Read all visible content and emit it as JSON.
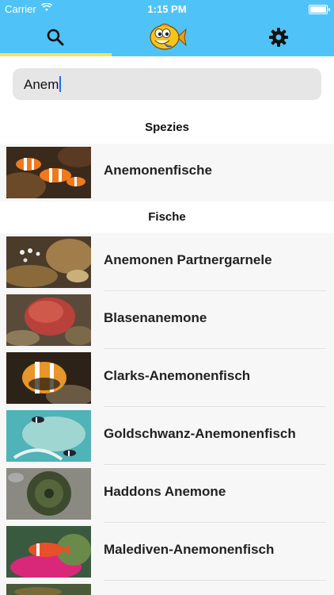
{
  "status_bar": {
    "carrier": "Carrier",
    "time": "1:15 PM"
  },
  "tabs": [
    {
      "name": "search",
      "icon": "search-icon"
    },
    {
      "name": "home",
      "icon": "fish-logo-icon"
    },
    {
      "name": "settings",
      "icon": "gear-icon"
    }
  ],
  "colors": {
    "header": "#4fc3f7",
    "active_tab_underline": "#f6e35a"
  },
  "search": {
    "value": "Anem"
  },
  "sections": [
    {
      "title": "Spezies",
      "items": [
        {
          "label": "Anemonenfische",
          "thumb": "clownfish-photo"
        }
      ]
    },
    {
      "title": "Fische",
      "items": [
        {
          "label": "Anemonen Partnergarnele",
          "thumb": "shrimp-photo"
        },
        {
          "label": "Blasenanemone",
          "thumb": "bubble-anemone-photo"
        },
        {
          "label": "Clarks-Anemonenfisch",
          "thumb": "clarks-clownfish-photo"
        },
        {
          "label": "Goldschwanz-Anemonenfisch",
          "thumb": "goldtail-clownfish-photo"
        },
        {
          "label": "Haddons Anemone",
          "thumb": "haddons-anemone-photo"
        },
        {
          "label": "Malediven-Anemonenfisch",
          "thumb": "maldives-clownfish-photo"
        }
      ]
    }
  ]
}
